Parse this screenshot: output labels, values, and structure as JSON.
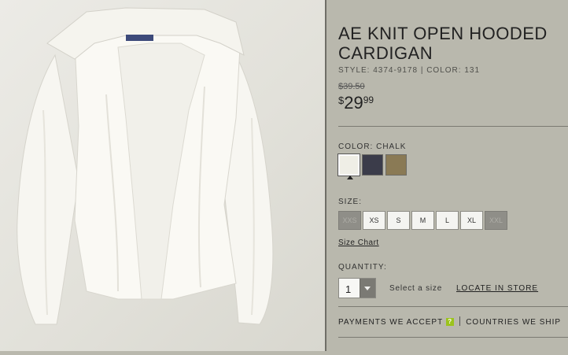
{
  "product": {
    "title": "AE KNIT OPEN HOODED CARDIGAN",
    "style_line": "STYLE: 4374-9178 | COLOR: 131",
    "old_price": "$39.50",
    "price_currency": "$",
    "price_dollars": "29",
    "price_cents": "99",
    "image_alt": "White knit open hooded cardigan"
  },
  "color": {
    "label": "COLOR: CHALK",
    "swatches": [
      {
        "name": "chalk",
        "hex": "#efeee6"
      },
      {
        "name": "navy",
        "hex": "#3b3c4a"
      },
      {
        "name": "olive",
        "hex": "#8a7a55"
      }
    ],
    "selected_index": 0
  },
  "size": {
    "label": "SIZE:",
    "options": [
      {
        "label": "XXS",
        "available": false
      },
      {
        "label": "XS",
        "available": true
      },
      {
        "label": "S",
        "available": true
      },
      {
        "label": "M",
        "available": true
      },
      {
        "label": "L",
        "available": true
      },
      {
        "label": "XL",
        "available": true
      },
      {
        "label": "XXL",
        "available": false
      }
    ],
    "chart_link": "Size Chart"
  },
  "quantity": {
    "label": "QUANTITY:",
    "value": "1",
    "select_size_text": "Select a size",
    "locate_link": "LOCATE IN STORE"
  },
  "footer": {
    "payments": "PAYMENTS WE ACCEPT",
    "help_icon": "?",
    "countries": "COUNTRIES WE SHIP"
  },
  "colors": {
    "panel_bg": "#b9b8ad",
    "help_green": "#9bc31c"
  }
}
